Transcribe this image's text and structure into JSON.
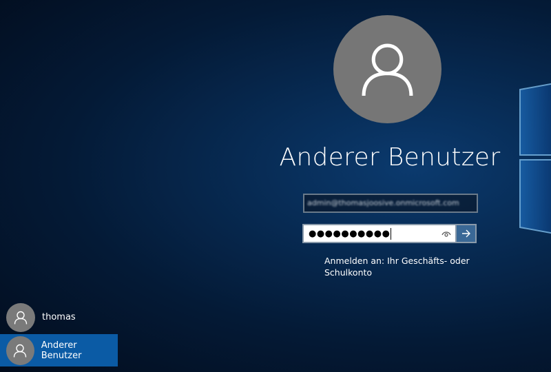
{
  "user": {
    "name": "Anderer Benutzer"
  },
  "login": {
    "email_value": "admin@thomasjoosive.onmicrosoft.com",
    "password_masked": "●●●●●●●●●●",
    "hint": "Anmelden an: Ihr Geschäfts- oder Schulkonto"
  },
  "accounts": [
    {
      "name": "thomas",
      "selected": false
    },
    {
      "name": "Anderer Benutzer",
      "selected": true
    }
  ],
  "colors": {
    "accent": "#0b5ba5",
    "submit": "#3a6896",
    "avatar": "#767676"
  }
}
